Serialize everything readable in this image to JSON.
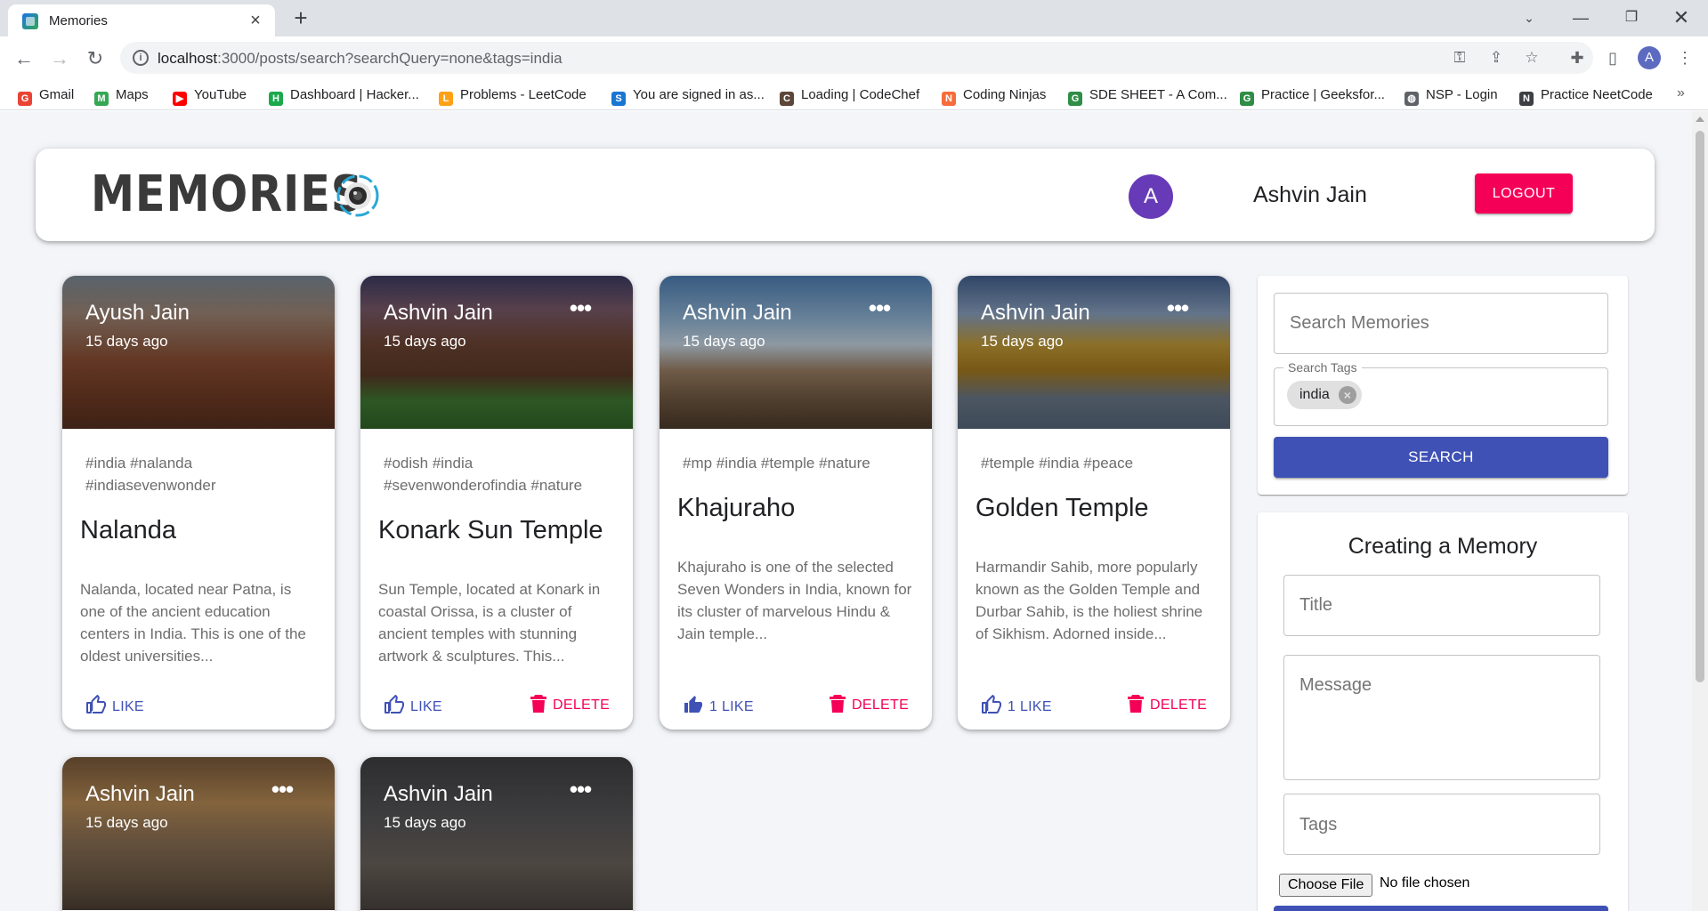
{
  "browser": {
    "tab_title": "Memories",
    "url_host": "localhost",
    "url_rest": ":3000/posts/search?searchQuery=none&tags=india",
    "profile_initial": "A"
  },
  "bookmarks": [
    {
      "label": "Gmail",
      "icon": "gmail-icon",
      "color": "#ea4335",
      "glyph": "G"
    },
    {
      "label": "Maps",
      "icon": "maps-icon",
      "color": "#34a853",
      "glyph": "M"
    },
    {
      "label": "YouTube",
      "icon": "youtube-icon",
      "color": "#ff0000",
      "glyph": "▶"
    },
    {
      "label": "Dashboard | Hacker...",
      "icon": "hackerrank-icon",
      "color": "#1ba94c",
      "glyph": "H"
    },
    {
      "label": "Problems - LeetCode",
      "icon": "leetcode-icon",
      "color": "#ffa116",
      "glyph": "L"
    },
    {
      "label": "You are signed in as...",
      "icon": "s-icon",
      "color": "#1976d2",
      "glyph": "S"
    },
    {
      "label": "Loading | CodeChef",
      "icon": "codechef-icon",
      "color": "#5b4638",
      "glyph": "C"
    },
    {
      "label": "Coding Ninjas",
      "icon": "codingninjas-icon",
      "color": "#f66c3b",
      "glyph": "N"
    },
    {
      "label": "SDE SHEET - A Com...",
      "icon": "gfg-icon",
      "color": "#2f8d46",
      "glyph": "G"
    },
    {
      "label": "Practice | Geeksfor...",
      "icon": "gfg-icon",
      "color": "#2f8d46",
      "glyph": "G"
    },
    {
      "label": "NSP - Login",
      "icon": "globe-icon",
      "color": "#5f6368",
      "glyph": "◍"
    },
    {
      "label": "Practice NeetCode",
      "icon": "neetcode-icon",
      "color": "#3c4043",
      "glyph": "N"
    }
  ],
  "header": {
    "brand": "MEMORIES",
    "avatar_initial": "A",
    "user_name": "Ashvin Jain",
    "logout_label": "LOGOUT"
  },
  "posts": [
    {
      "author": "Ayush Jain",
      "time": "15 days ago",
      "tags": "#india #nalanda #indiasevenwonder",
      "title": "Nalanda",
      "message": "Nalanda, located near Patna, is one of the ancient education centers in India. This is one of the oldest universities...",
      "likes": "LIKE",
      "delete": ""
    },
    {
      "author": "Ashvin Jain",
      "time": "15 days ago",
      "tags": "#odish #india #sevenwonderofindia #nature",
      "title": "Konark Sun Temple",
      "message": "Sun Temple, located at Konark in coastal Orissa, is a cluster of ancient temples with stunning artwork & sculptures. This...",
      "likes": "LIKE",
      "delete": "DELETE"
    },
    {
      "author": "Ashvin Jain",
      "time": "15 days ago",
      "tags": "#mp #india #temple #nature",
      "title": "Khajuraho",
      "message": "Khajuraho is one of the selected Seven Wonders in India, known for its cluster of marvelous Hindu & Jain temple...",
      "likes": "1 LIKE",
      "delete": "DELETE"
    },
    {
      "author": "Ashvin Jain",
      "time": "15 days ago",
      "tags": "#temple #india #peace",
      "title": "Golden Temple",
      "message": "Harmandir Sahib, more popularly known as the Golden Temple and Durbar Sahib, is the holiest shrine of Sikhism. Adorned inside...",
      "likes": "1 LIKE",
      "delete": "DELETE"
    },
    {
      "author": "Ashvin Jain",
      "time": "15 days ago"
    },
    {
      "author": "Ashvin Jain",
      "time": "15 days ago"
    }
  ],
  "search": {
    "placeholder": "Search Memories",
    "tags_label": "Search Tags",
    "tag_chip": "india",
    "button_label": "SEARCH"
  },
  "form": {
    "title": "Creating a Memory",
    "title_placeholder": "Title",
    "message_placeholder": "Message",
    "tags_placeholder": "Tags",
    "file_button": "Choose File",
    "file_status": "No file chosen"
  },
  "colors": {
    "primary": "#3f51b5",
    "secondary": "#f50057",
    "avatar": "#673ab7",
    "page_bg": "#f4f5f9"
  }
}
